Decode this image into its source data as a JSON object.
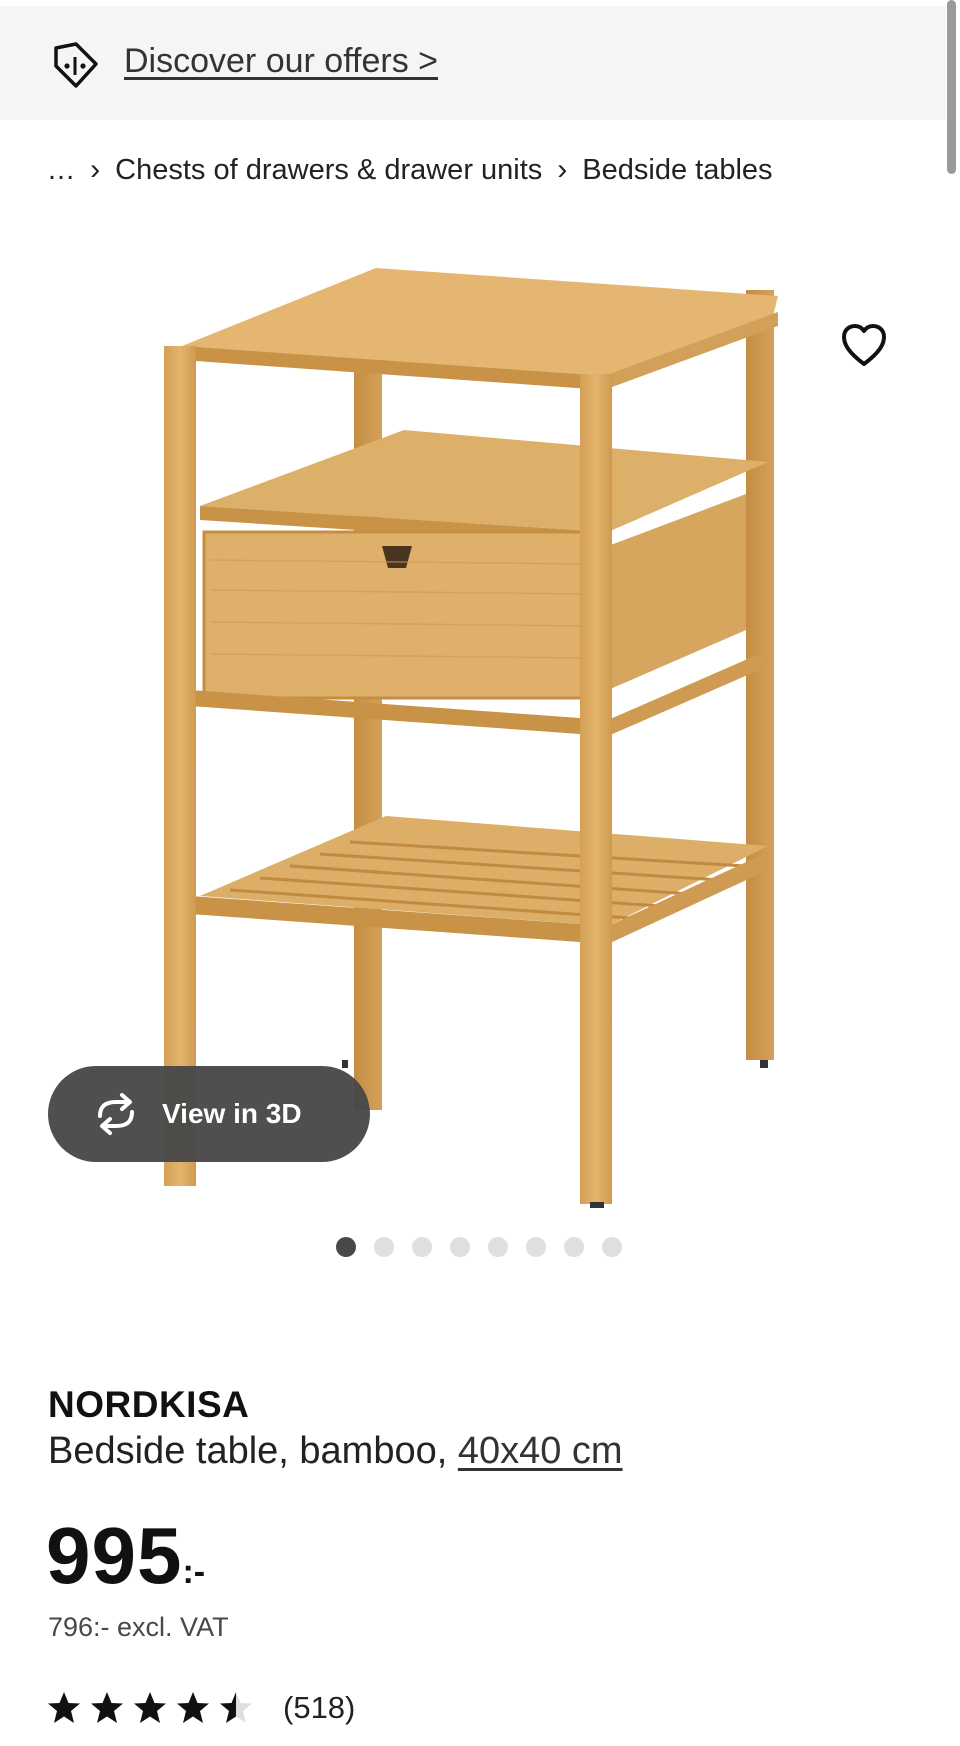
{
  "offers_bar": {
    "icon": "tag-icon",
    "link_text": "Discover our offers >"
  },
  "breadcrumb": {
    "items": [
      "...",
      "Chests of drawers & drawer units",
      "Bedside tables"
    ],
    "separator": "›"
  },
  "gallery": {
    "favourite_icon": "heart-icon",
    "view_3d_label": "View in 3D",
    "view_3d_icon": "rotate-icon",
    "image_count": 8,
    "active_image_index": 0
  },
  "product": {
    "name": "NORDKISA",
    "description": "Bedside table, bamboo, ",
    "size": "40x40 cm",
    "price_integer": "995",
    "price_suffix": ":-",
    "price_excl_vat": "796:- excl. VAT",
    "rating": 4.5,
    "rating_max": 5,
    "review_count": "(518)"
  },
  "colors": {
    "wood": "#d9a75c",
    "dark_button": "#484848",
    "bar_bg": "#f5f5f5"
  }
}
